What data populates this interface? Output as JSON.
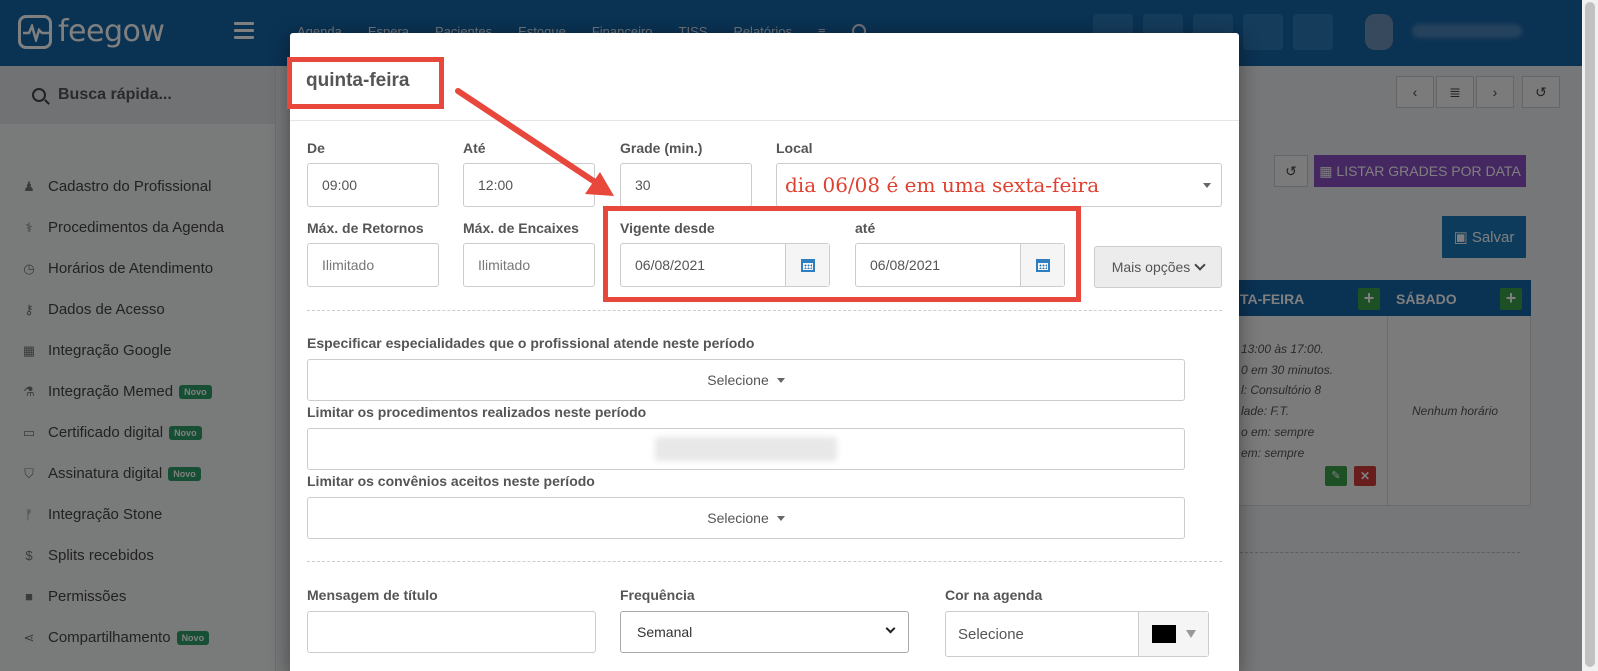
{
  "app": {
    "logo_text": "feegow",
    "top_nav": [
      "Agenda",
      "Espera",
      "Pacientes",
      "Estoque",
      "Financeiro",
      "TISS",
      "Relatórios"
    ]
  },
  "sidebar": {
    "quick_search": "Busca rápida...",
    "items": [
      {
        "label": "Cadastro do Profissional",
        "icon": "user-icon",
        "glyph": "♟"
      },
      {
        "label": "Procedimentos da Agenda",
        "icon": "stethoscope-icon",
        "glyph": "⚕"
      },
      {
        "label": "Horários de Atendimento",
        "icon": "clock-icon",
        "glyph": "◷"
      },
      {
        "label": "Dados de Acesso",
        "icon": "key-icon",
        "glyph": "⚷"
      },
      {
        "label": "Integração Google",
        "icon": "calendar-icon",
        "glyph": "▦"
      },
      {
        "label": "Integração Memed",
        "icon": "flask-icon",
        "glyph": "⚗",
        "badge": "Novo"
      },
      {
        "label": "Certificado digital",
        "icon": "card-icon",
        "glyph": "▭",
        "badge": "Novo"
      },
      {
        "label": "Assinatura digital",
        "icon": "shield-icon",
        "glyph": "⛉",
        "badge": "Novo"
      },
      {
        "label": "Integração Stone",
        "icon": "branch-icon",
        "glyph": "ᚠ"
      },
      {
        "label": "Splits recebidos",
        "icon": "dollar-icon",
        "glyph": "$"
      },
      {
        "label": "Permissões",
        "icon": "lock-icon",
        "glyph": "🔒"
      },
      {
        "label": "Compartilhamento",
        "icon": "share-icon",
        "glyph": "⋖",
        "badge": "Novo"
      }
    ]
  },
  "background": {
    "listar_label": "LISTAR GRADES POR DATA",
    "salvar_label": "Salvar",
    "grid_col1": "TA-FEIRA",
    "grid_col2": "SÁBADO",
    "grid_lines": [
      "13:00 às 17:00.",
      "0 em 30 minutos.",
      "l: Consultório 8",
      "lade: F.T.",
      "o em: sempre",
      "em: sempre"
    ],
    "nenhum": "Nenhum horário"
  },
  "modal": {
    "title": "quinta-feira",
    "de_label": "De",
    "de_value": "09:00",
    "ate_label": "Até",
    "ate_value": "12:00",
    "grade_label": "Grade (min.)",
    "grade_value": "30",
    "local_label": "Local",
    "local_annotation": "dia 06/08 é em uma sexta-feira",
    "max_retornos_label": "Máx. de Retornos",
    "max_retornos_placeholder": "Ilimitado",
    "max_encaixes_label": "Máx. de Encaixes",
    "max_encaixes_placeholder": "Ilimitado",
    "vigente_desde_label": "Vigente desde",
    "vigente_desde_value": "06/08/2021",
    "vigente_ate_label": "até",
    "vigente_ate_value": "06/08/2021",
    "mais_opcoes_label": "Mais opções",
    "especialidades_label": "Especificar especialidades que o profissional atende neste período",
    "especialidades_value": "Selecione",
    "procedimentos_label": "Limitar os procedimentos realizados neste período",
    "convenios_label": "Limitar os convênios aceitos neste período",
    "convenios_value": "Selecione",
    "mensagem_label": "Mensagem de título",
    "frequencia_label": "Frequência",
    "frequencia_value": "Semanal",
    "cor_label": "Cor na agenda",
    "cor_value": "Selecione",
    "cor_swatch": "#000000"
  },
  "colors": {
    "annotation": "#e8473b",
    "topbar": "#1565a6",
    "listar": "#8a4fc4",
    "novo_badge": "#2e9e6a"
  }
}
